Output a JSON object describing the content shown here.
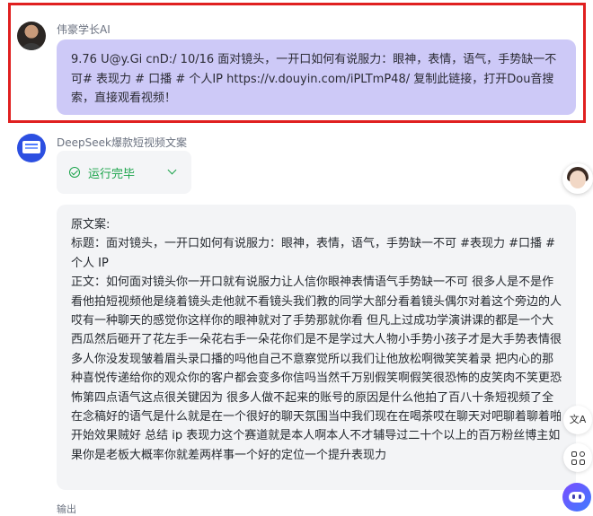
{
  "user_message": {
    "username": "伟豪学长AI",
    "text": "9.76 U@y.Gi cnD:/ 10/16 面对镜头，一开口如何有说服力：眼神，表情，语气，手势缺一不可# 表现力 # 口播 # 个人IP  https://v.douyin.com/iPLTmP48/ 复制此链接，打开Dou音搜索，直接观看视频！",
    "avatar_icon": "user-avatar"
  },
  "bot_message": {
    "botname": "DeepSeek爆款短视频文案",
    "status": "运行完毕",
    "status_color": "#1aa34a",
    "lines": [
      "原文案:",
      "标题：面对镜头，一开口如何有说服力：眼神，表情，语气，手势缺一不可 #表现力 #口播 #个人 IP",
      "正文：如何面对镜头你一开口就有说服力让人信你眼神表情语气手势缺一不可 很多人是不是作看他拍短视频他是绕着镜头走他就不看镜头我们教的同学大部分看着镜头偶尔对着这个旁边的人哎有一种聊天的感觉你这样你的眼神就对了手势那就你看 但凡上过成功学演讲课的都是一个大西瓜然后砸开了花左手一朵花右手一朵花你们是不是学过大人物小手势小孩子才是大手势表情很多人你没发现皱着眉头录口播的吗他自己不意察觉所以我们让他放松啊微笑笑着录 把内心的那种喜悦传递给你的观众你的客户都会变多你信吗当然千万别假笑啊假笑很恐怖的皮笑肉不笑更恐怖第四点语气这点很关键因为 很多人做不起来的账号的原因是什么他拍了百八十条短视频了全在念稿好的语气是什么就是在一个很好的聊天氛围当中我们现在在喝茶哎在聊天对吧聊着聊着啪开始效果贼好 总结 ip 表现力这个赛道就是本人啊本人不才辅导过二十个以上的百万粉丝博主如果你是老板大概率你就差两样事一个好的定位一个提升表现力"
    ]
  },
  "next_message_peek": "输出",
  "side_tools": {
    "translate_label": "文A",
    "highlight_color": "#e02020",
    "bubble_user_color": "#cdc9f7"
  }
}
